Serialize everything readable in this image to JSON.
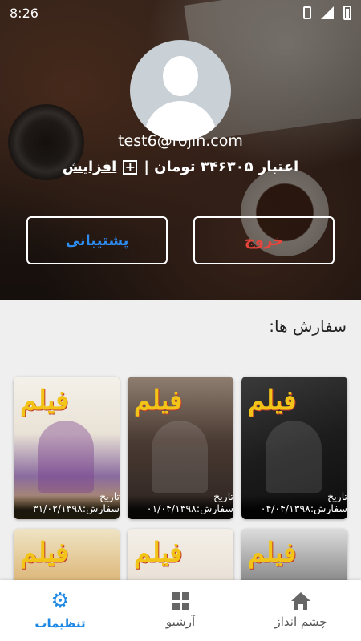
{
  "status_bar": {
    "time": "8:26"
  },
  "profile": {
    "email": "test6@rojin.com",
    "credit_label": "اعتبار ۳۴۶۳۰۵ تومان |",
    "increase_label": "افزایش"
  },
  "buttons": {
    "support": "پشتیبانی",
    "logout": "خروج"
  },
  "orders": {
    "title": "سفارش ها:",
    "items": [
      {
        "caption": "تاریخ سفارش:۰۴/۰۴/۱۳۹۸",
        "logo": "فیلم"
      },
      {
        "caption": "تاریخ سفارش:۰۱/۰۴/۱۳۹۸",
        "logo": "فیلم"
      },
      {
        "caption": "تاریخ سفارش:۳۱/۰۲/۱۳۹۸",
        "logo": "فیلم"
      },
      {
        "caption": "",
        "logo": "فیلم"
      },
      {
        "caption": "",
        "logo": "فیلم"
      },
      {
        "caption": "",
        "logo": "فیلم"
      }
    ]
  },
  "bottom_nav": {
    "items": [
      {
        "label": "چشم انداز",
        "icon": "home-icon"
      },
      {
        "label": "آرشیو",
        "icon": "dashboard-icon"
      },
      {
        "label": "تنظیمات",
        "icon": "gear-icon"
      }
    ],
    "active_color": "#1e88e5"
  }
}
